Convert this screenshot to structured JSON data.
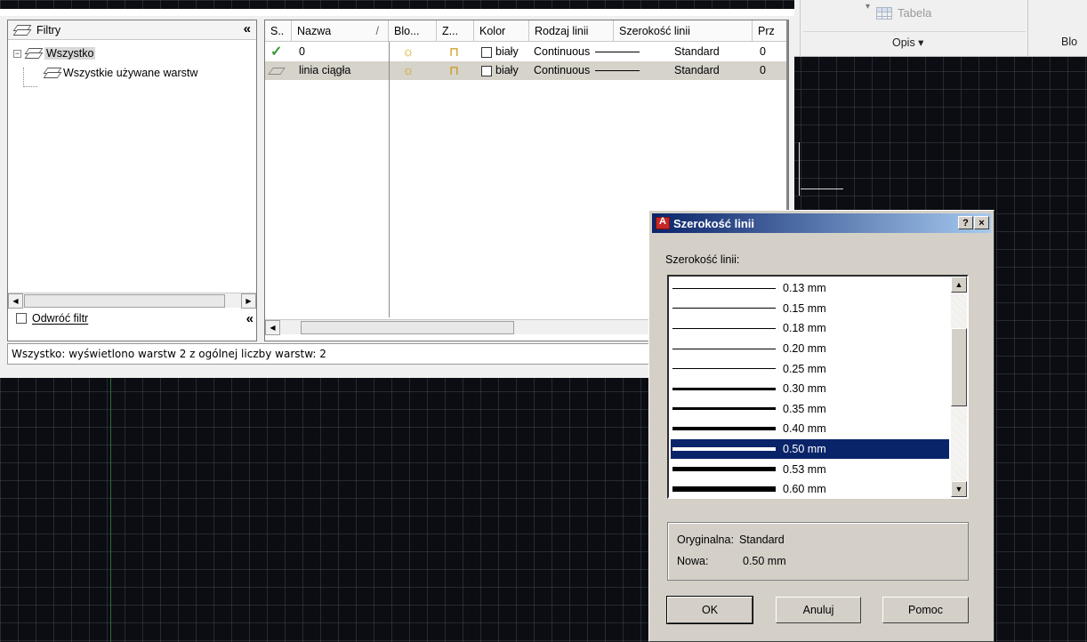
{
  "ribbon": {
    "tabela_label": "Tabela",
    "group_label": "Opis ▾",
    "group2_label": "Blo",
    "dot": "▾"
  },
  "filters": {
    "header": "Filtry",
    "collapse": "«",
    "tree": {
      "root": "Wszystko",
      "child": "Wszystkie używane warstw"
    },
    "invert_label": "Odwróć filtr",
    "invert_checked": false
  },
  "grid": {
    "columns": [
      "S..",
      "Nazwa",
      "Blo...",
      "Z...",
      "Kolor",
      "Rodzaj linii",
      "Szerokość linii",
      "Prz"
    ],
    "rows": [
      {
        "status": "✓",
        "name": "0",
        "freeze": "☼",
        "lock": "🔓",
        "color": "biały",
        "linetype": "Continuous",
        "lineweight": "Standard",
        "plot": "0"
      },
      {
        "status": "",
        "name": "linia ciągła",
        "freeze": "☼",
        "lock": "🔓",
        "color": "biały",
        "linetype": "Continuous",
        "lineweight": "Standard",
        "plot": "0"
      }
    ]
  },
  "status_bar": "Wszystko: wyświetlono warstw 2 z ogólnej liczby warstw: 2",
  "dialog": {
    "title": "Szerokość linii",
    "help_btn": "?",
    "close_btn": "×",
    "list_label": "Szerokość linii:",
    "items": [
      {
        "label": "0.13 mm",
        "thickness": 1
      },
      {
        "label": "0.15 mm",
        "thickness": 1
      },
      {
        "label": "0.18 mm",
        "thickness": 1
      },
      {
        "label": "0.20 mm",
        "thickness": 1
      },
      {
        "label": "0.25 mm",
        "thickness": 1
      },
      {
        "label": "0.30 mm",
        "thickness": 3
      },
      {
        "label": "0.35 mm",
        "thickness": 3
      },
      {
        "label": "0.40 mm",
        "thickness": 4
      },
      {
        "label": "0.50 mm",
        "thickness": 4
      },
      {
        "label": "0.53 mm",
        "thickness": 5
      },
      {
        "label": "0.60 mm",
        "thickness": 6
      }
    ],
    "selected_index": 8,
    "original_label": "Oryginalna:",
    "original_value": "Standard",
    "new_label": "Nowa:",
    "new_value": "0.50 mm",
    "ok": "OK",
    "cancel": "Anuluj",
    "help": "Pomoc"
  }
}
